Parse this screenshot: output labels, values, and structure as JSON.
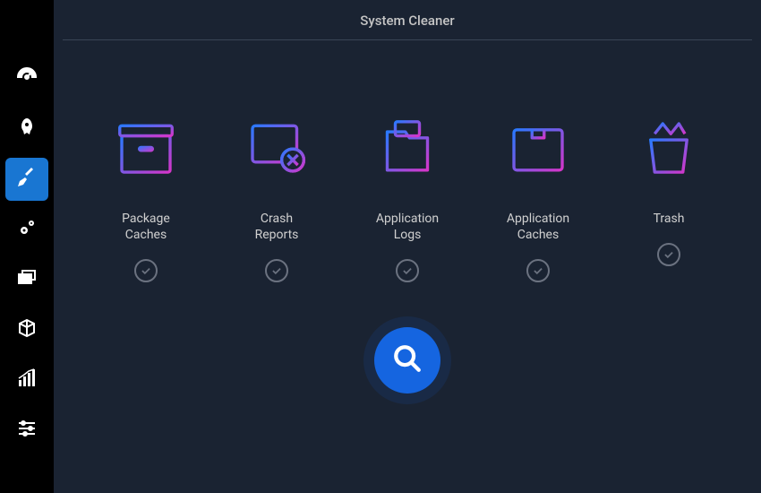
{
  "header": {
    "title": "System Cleaner"
  },
  "sidebar": {
    "items": [
      {
        "name": "dashboard",
        "active": false
      },
      {
        "name": "startup",
        "active": false
      },
      {
        "name": "cleaner",
        "active": true
      },
      {
        "name": "services",
        "active": false
      },
      {
        "name": "processes",
        "active": false
      },
      {
        "name": "uninstaller",
        "active": false
      },
      {
        "name": "resources",
        "active": false
      },
      {
        "name": "settings",
        "active": false
      }
    ]
  },
  "categories": [
    {
      "id": "package-caches",
      "label": "Package\nCaches",
      "checked": true
    },
    {
      "id": "crash-reports",
      "label": "Crash\nReports",
      "checked": true
    },
    {
      "id": "application-logs",
      "label": "Application\nLogs",
      "checked": true
    },
    {
      "id": "application-caches",
      "label": "Application\nCaches",
      "checked": true
    },
    {
      "id": "trash",
      "label": "Trash",
      "checked": true
    }
  ],
  "scan_button": {
    "label": "Scan"
  },
  "colors": {
    "accent": "#1565e0",
    "gradient_start": "#2979ff",
    "gradient_end": "#d535c9"
  }
}
